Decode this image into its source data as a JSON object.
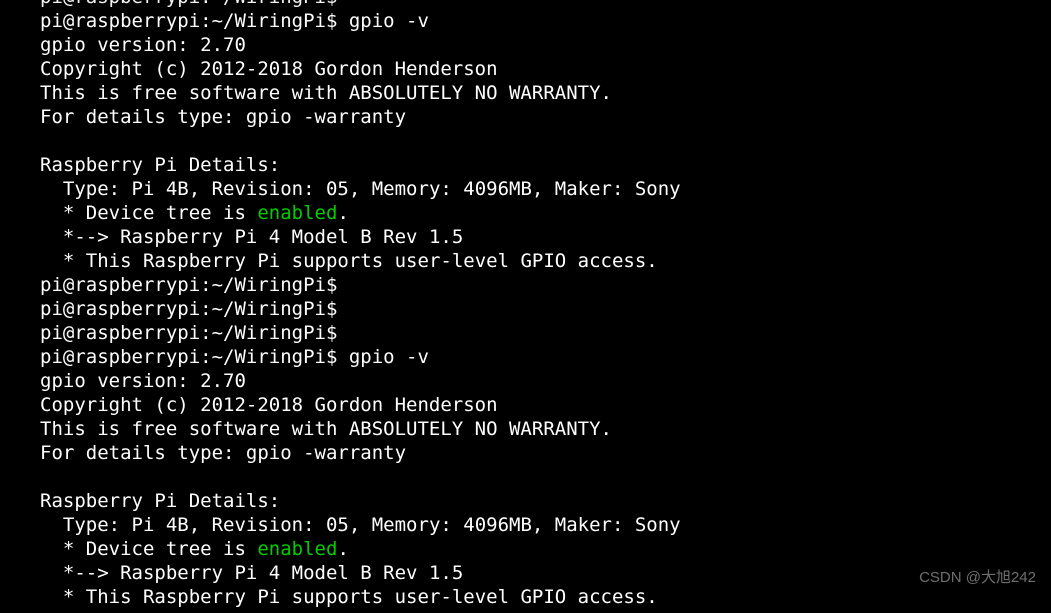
{
  "terminal": {
    "lines": [
      {
        "segments": [
          {
            "text": "pi@raspberrypi:~/WiringPi$",
            "c": "white",
            "cut": true
          }
        ],
        "partial_top": true
      },
      {
        "segments": [
          {
            "text": "pi@raspberrypi:~/WiringPi$ gpio -v",
            "c": "white"
          }
        ]
      },
      {
        "segments": [
          {
            "text": "gpio version: 2.70",
            "c": "white"
          }
        ]
      },
      {
        "segments": [
          {
            "text": "Copyright (c) 2012-2018 Gordon Henderson",
            "c": "white"
          }
        ]
      },
      {
        "segments": [
          {
            "text": "This is free software with ABSOLUTELY NO WARRANTY.",
            "c": "white"
          }
        ]
      },
      {
        "segments": [
          {
            "text": "For details type: gpio -warranty",
            "c": "white"
          }
        ]
      },
      {
        "segments": [
          {
            "text": "",
            "c": "white"
          }
        ]
      },
      {
        "segments": [
          {
            "text": "Raspberry Pi Details:",
            "c": "white"
          }
        ]
      },
      {
        "segments": [
          {
            "text": "  Type: Pi 4B, Revision: 05, Memory: 4096MB, Maker: Sony",
            "c": "white"
          }
        ]
      },
      {
        "segments": [
          {
            "text": "  * Device tree is ",
            "c": "white"
          },
          {
            "text": "enabled",
            "c": "green"
          },
          {
            "text": ".",
            "c": "white"
          }
        ]
      },
      {
        "segments": [
          {
            "text": "  *--> Raspberry Pi 4 Model B Rev 1.5",
            "c": "white"
          }
        ]
      },
      {
        "segments": [
          {
            "text": "  * This Raspberry Pi supports user-level GPIO access.",
            "c": "white"
          }
        ]
      },
      {
        "segments": [
          {
            "text": "pi@raspberrypi:~/WiringPi$",
            "c": "white"
          }
        ]
      },
      {
        "segments": [
          {
            "text": "pi@raspberrypi:~/WiringPi$",
            "c": "white"
          }
        ]
      },
      {
        "segments": [
          {
            "text": "pi@raspberrypi:~/WiringPi$",
            "c": "white"
          }
        ]
      },
      {
        "segments": [
          {
            "text": "pi@raspberrypi:~/WiringPi$ gpio -v",
            "c": "white"
          }
        ]
      },
      {
        "segments": [
          {
            "text": "gpio version: 2.70",
            "c": "white"
          }
        ]
      },
      {
        "segments": [
          {
            "text": "Copyright (c) 2012-2018 Gordon Henderson",
            "c": "white"
          }
        ]
      },
      {
        "segments": [
          {
            "text": "This is free software with ABSOLUTELY NO WARRANTY.",
            "c": "white"
          }
        ]
      },
      {
        "segments": [
          {
            "text": "For details type: gpio -warranty",
            "c": "white"
          }
        ]
      },
      {
        "segments": [
          {
            "text": "",
            "c": "white"
          }
        ]
      },
      {
        "segments": [
          {
            "text": "Raspberry Pi Details:",
            "c": "white"
          }
        ]
      },
      {
        "segments": [
          {
            "text": "  Type: Pi 4B, Revision: 05, Memory: 4096MB, Maker: Sony",
            "c": "white"
          }
        ]
      },
      {
        "segments": [
          {
            "text": "  * Device tree is ",
            "c": "white"
          },
          {
            "text": "enabled",
            "c": "green"
          },
          {
            "text": ".",
            "c": "white"
          }
        ]
      },
      {
        "segments": [
          {
            "text": "  *--> Raspberry Pi 4 Model B Rev 1.5",
            "c": "white"
          }
        ]
      },
      {
        "segments": [
          {
            "text": "  * This Raspberry Pi supports user-level GPIO access.",
            "c": "white"
          }
        ]
      }
    ]
  },
  "watermark": "CSDN @大旭242"
}
